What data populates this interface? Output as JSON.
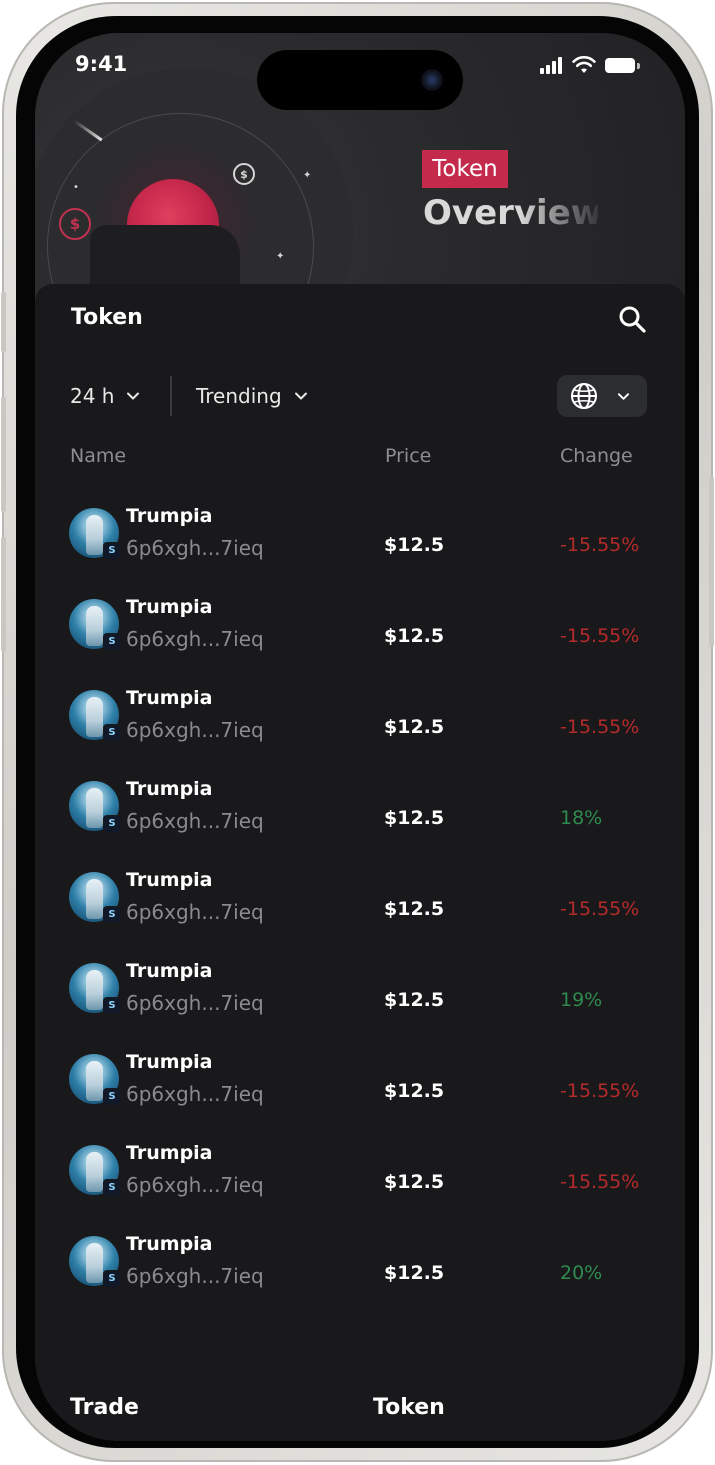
{
  "status_bar": {
    "time": "9:41"
  },
  "hero": {
    "tag": "Token",
    "title": "Overview"
  },
  "panel": {
    "title": "Token"
  },
  "filters": {
    "period": "24 h",
    "sort": "Trending"
  },
  "columns": {
    "name": "Name",
    "price": "Price",
    "change": "Change"
  },
  "tokens": [
    {
      "name": "Trumpia",
      "address": "6p6xgh...7ieq",
      "price": "$12.5",
      "change": "-15.55%",
      "trend": "down"
    },
    {
      "name": "Trumpia",
      "address": "6p6xgh...7ieq",
      "price": "$12.5",
      "change": "-15.55%",
      "trend": "down"
    },
    {
      "name": "Trumpia",
      "address": "6p6xgh...7ieq",
      "price": "$12.5",
      "change": "-15.55%",
      "trend": "down"
    },
    {
      "name": "Trumpia",
      "address": "6p6xgh...7ieq",
      "price": "$12.5",
      "change": "18%",
      "trend": "up"
    },
    {
      "name": "Trumpia",
      "address": "6p6xgh...7ieq",
      "price": "$12.5",
      "change": "-15.55%",
      "trend": "down"
    },
    {
      "name": "Trumpia",
      "address": "6p6xgh...7ieq",
      "price": "$12.5",
      "change": "19%",
      "trend": "up"
    },
    {
      "name": "Trumpia",
      "address": "6p6xgh...7ieq",
      "price": "$12.5",
      "change": "-15.55%",
      "trend": "down"
    },
    {
      "name": "Trumpia",
      "address": "6p6xgh...7ieq",
      "price": "$12.5",
      "change": "-15.55%",
      "trend": "down"
    },
    {
      "name": "Trumpia",
      "address": "6p6xgh...7ieq",
      "price": "$12.5",
      "change": "20%",
      "trend": "up"
    }
  ],
  "bottom_tabs": {
    "trade": "Trade",
    "token": "Token"
  },
  "icons": {
    "search": "search-icon",
    "period_chevron": "chevron-down-icon",
    "sort_chevron": "chevron-down-icon",
    "region": "globe-icon",
    "region_chevron": "chevron-down-icon",
    "chain_badge": "solana-icon"
  },
  "colors": {
    "accent": "#c42a4c",
    "negative": "#b52a2a",
    "positive": "#2e8a4f",
    "panel_bg": "#19191b",
    "muted_text": "#8a8a90"
  }
}
